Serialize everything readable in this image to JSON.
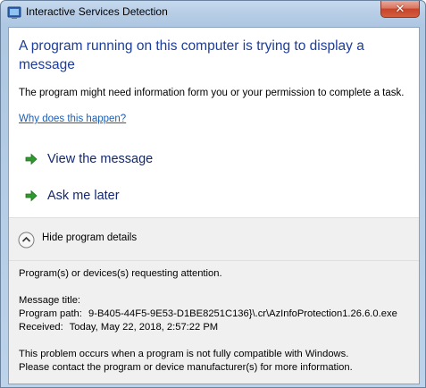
{
  "window": {
    "title": "Interactive Services Detection",
    "close_glyph": "✕"
  },
  "main_instruction": "A program running on this computer is trying to display a message",
  "content": "The program might need information form you or your permission to complete a task.",
  "why_link": "Why does this happen?",
  "commands": [
    {
      "label": "View the message",
      "icon": "green-arrow-icon"
    },
    {
      "label": "Ask me later",
      "icon": "green-arrow-icon"
    }
  ],
  "expander": {
    "label": "Hide program details",
    "icon": "chevron-up-icon"
  },
  "details": {
    "requesting": "Program(s) or devices(s) requesting attention.",
    "message_title_label": "Message title:",
    "program_path_label": "Program path:",
    "program_path_value": "9-B405-44F5-9E53-D1BE8251C136}\\.cr\\AzInfoProtection1.26.6.0.exe",
    "received_label": "Received:",
    "received_value": "Today, May 22, 2018, 2:57:22 PM",
    "footer_1": "This problem occurs when a program is not fully compatible with Windows.",
    "footer_2": "Please contact the program or device manufacturer(s) for more information."
  },
  "colors": {
    "instruction": "#1d3d9b",
    "link": "#1a5fb4",
    "command": "#14286d",
    "arrow": "#2e9a2e",
    "close_button": "#c7442a"
  }
}
